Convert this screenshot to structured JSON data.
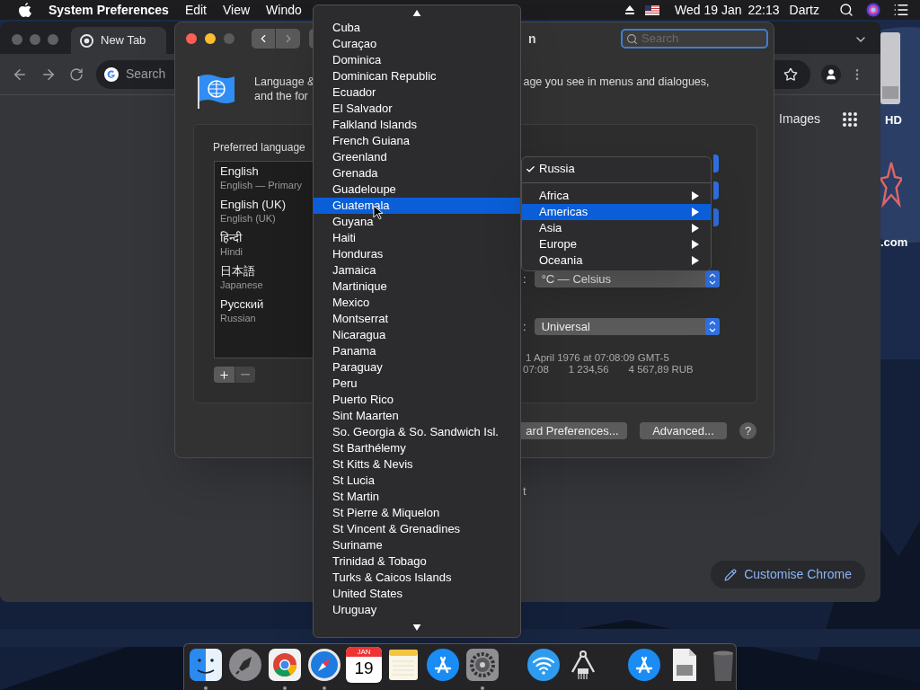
{
  "menu_bar": {
    "app": "System Preferences",
    "menus": [
      "Edit",
      "View",
      "Windo"
    ],
    "date": "Wed 19 Jan",
    "time": "22:13",
    "user": "Dartz"
  },
  "desktop": {
    "labels": [
      "HD",
      ".com"
    ]
  },
  "browser": {
    "tab": {
      "title": "New Tab",
      "selected": true
    },
    "omnibox": {
      "placeholder": "Search"
    },
    "links": [
      "Images"
    ],
    "fragment": "t",
    "customise_button": "Customise Chrome"
  },
  "prefs_window": {
    "title": "n",
    "search": {
      "placeholder": "Search"
    },
    "description_left": [
      "Language &",
      "and the for"
    ],
    "description_right": "age you see in menus and dialogues,",
    "preferred_label": "Preferred language",
    "languages": [
      {
        "name": "English",
        "detail": "English — Primary"
      },
      {
        "name": "English (UK)",
        "detail": "English (UK)"
      },
      {
        "name": "हिन्दी",
        "detail": "Hindi"
      },
      {
        "name": "日本語",
        "detail": "Japanese"
      },
      {
        "name": "Русский",
        "detail": "Russian"
      }
    ],
    "settings": [
      {
        "label": ":",
        "value": "°C — Celsius"
      },
      {
        "label": ":",
        "value": "Universal"
      }
    ],
    "sample_date": "1 April 1976 at 07:08:09 GMT-5",
    "sample_parts": [
      "07:08",
      "1 234,56",
      "4 567,89 RUB"
    ],
    "buttons": [
      "ard Preferences...",
      "Advanced..."
    ],
    "help": "?"
  },
  "country_menu": {
    "items": [
      {
        "label": "Cuba",
        "selected": false
      },
      {
        "label": "Curaçao",
        "selected": false
      },
      {
        "label": "Dominica",
        "selected": false
      },
      {
        "label": "Dominican Republic",
        "selected": false
      },
      {
        "label": "Ecuador",
        "selected": false
      },
      {
        "label": "El Salvador",
        "selected": false
      },
      {
        "label": "Falkland Islands",
        "selected": false
      },
      {
        "label": "French Guiana",
        "selected": false
      },
      {
        "label": "Greenland",
        "selected": false
      },
      {
        "label": "Grenada",
        "selected": false
      },
      {
        "label": "Guadeloupe",
        "selected": false
      },
      {
        "label": "Guatemala",
        "selected": true
      },
      {
        "label": "Guyana",
        "selected": false
      },
      {
        "label": "Haiti",
        "selected": false
      },
      {
        "label": "Honduras",
        "selected": false
      },
      {
        "label": "Jamaica",
        "selected": false
      },
      {
        "label": "Martinique",
        "selected": false
      },
      {
        "label": "Mexico",
        "selected": false
      },
      {
        "label": "Montserrat",
        "selected": false
      },
      {
        "label": "Nicaragua",
        "selected": false
      },
      {
        "label": "Panama",
        "selected": false
      },
      {
        "label": "Paraguay",
        "selected": false
      },
      {
        "label": "Peru",
        "selected": false
      },
      {
        "label": "Puerto Rico",
        "selected": false
      },
      {
        "label": "Sint Maarten",
        "selected": false
      },
      {
        "label": "So. Georgia & So. Sandwich Isl.",
        "selected": false
      },
      {
        "label": "St Barthélemy",
        "selected": false
      },
      {
        "label": "St Kitts & Nevis",
        "selected": false
      },
      {
        "label": "St Lucia",
        "selected": false
      },
      {
        "label": "St Martin",
        "selected": false
      },
      {
        "label": "St Pierre & Miquelon",
        "selected": false
      },
      {
        "label": "St Vincent & Grenadines",
        "selected": false
      },
      {
        "label": "Suriname",
        "selected": false
      },
      {
        "label": "Trinidad & Tobago",
        "selected": false
      },
      {
        "label": "Turks & Caicos Islands",
        "selected": false
      },
      {
        "label": "United States",
        "selected": false
      },
      {
        "label": "Uruguay",
        "selected": false
      }
    ]
  },
  "region_menu": {
    "current": {
      "label": "Russia",
      "checked": true
    },
    "regions": [
      {
        "label": "Africa",
        "selected": false
      },
      {
        "label": "Americas",
        "selected": true
      },
      {
        "label": "Asia",
        "selected": false
      },
      {
        "label": "Europe",
        "selected": false
      },
      {
        "label": "Oceania",
        "selected": false
      }
    ]
  },
  "dock": {
    "items": [
      {
        "kind": "finder",
        "running": true
      },
      {
        "kind": "launchpad",
        "running": false
      },
      {
        "kind": "chrome",
        "running": true
      },
      {
        "kind": "safari",
        "running": true
      },
      {
        "kind": "calendar",
        "month": "JAN",
        "day": "19",
        "running": false
      },
      {
        "kind": "notes",
        "running": false
      },
      {
        "kind": "appstore",
        "running": false
      },
      {
        "kind": "settings",
        "running": true
      },
      {
        "kind": "separator"
      },
      {
        "kind": "wifi",
        "running": false
      },
      {
        "kind": "caliper",
        "running": false
      },
      {
        "kind": "separator"
      },
      {
        "kind": "appstore",
        "running": false
      },
      {
        "kind": "document",
        "running": false
      },
      {
        "kind": "trash",
        "running": false
      }
    ]
  }
}
